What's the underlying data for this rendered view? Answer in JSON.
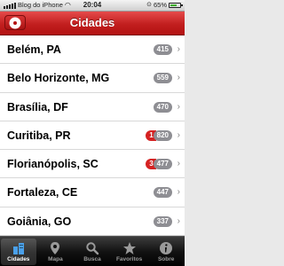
{
  "status_bar": {
    "carrier": "Blog do iPhone",
    "time": "20:04",
    "battery": "65%"
  },
  "nav": {
    "title": "Cidades",
    "left_button_icon": "gear-icon"
  },
  "cities": [
    {
      "name": "Belém, PA",
      "count": "415",
      "alert": ""
    },
    {
      "name": "Belo Horizonte, MG",
      "count": "559",
      "alert": ""
    },
    {
      "name": "Brasília, DF",
      "count": "470",
      "alert": ""
    },
    {
      "name": "Curitiba, PR",
      "count": "820",
      "alert": "1"
    },
    {
      "name": "Florianópolis, SC",
      "count": "477",
      "alert": "3"
    },
    {
      "name": "Fortaleza, CE",
      "count": "447",
      "alert": ""
    },
    {
      "name": "Goiânia, GO",
      "count": "337",
      "alert": ""
    }
  ],
  "tabs": [
    {
      "label": "Cidades",
      "icon": "city-icon",
      "active": true
    },
    {
      "label": "Mapa",
      "icon": "map-pin-icon",
      "active": false
    },
    {
      "label": "Busca",
      "icon": "search-icon",
      "active": false
    },
    {
      "label": "Favoritos",
      "icon": "star-icon",
      "active": false
    },
    {
      "label": "Sobre",
      "icon": "info-icon",
      "active": false
    }
  ],
  "colors": {
    "nav_red": "#c21f1f",
    "badge_gray": "#8e8e93",
    "alert_red": "#d52222",
    "tab_active_icon": "#4aa0ea"
  }
}
